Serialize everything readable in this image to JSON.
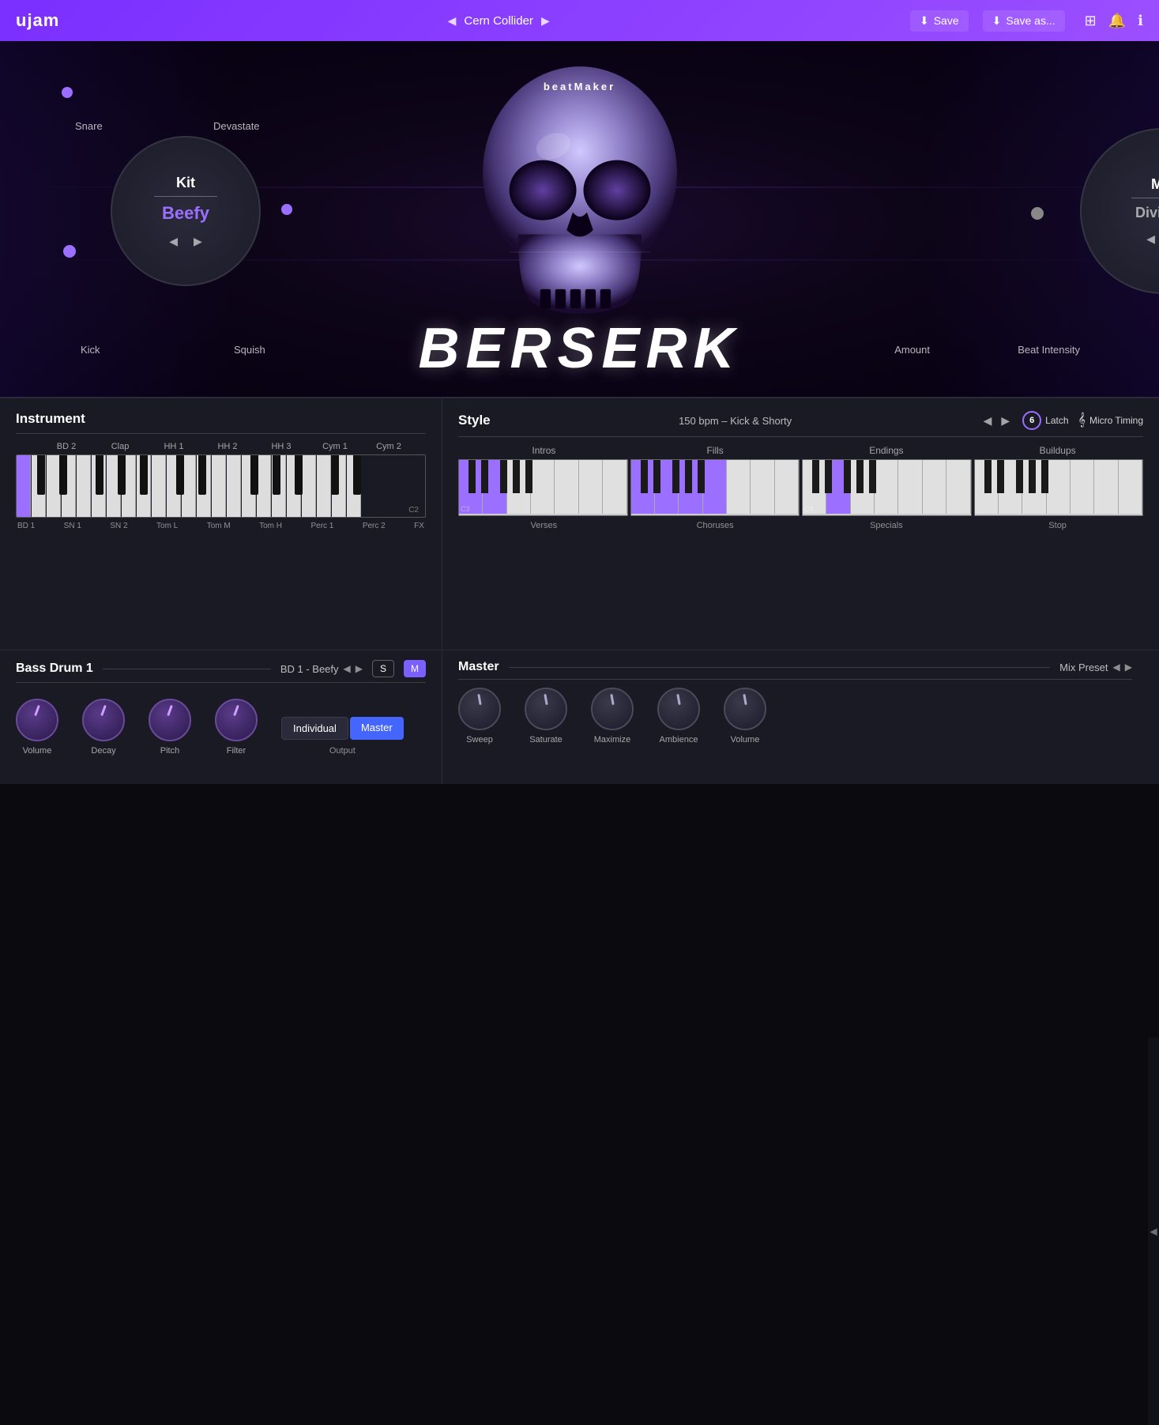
{
  "app": {
    "logo": "ujam",
    "preset_name": "Cern Collider",
    "save_label": "Save",
    "save_as_label": "Save as..."
  },
  "hero": {
    "beatmaker_label": "beatMaker",
    "product_name": "BERSERK",
    "kit_title": "Kit",
    "kit_value": "Beefy",
    "mix_title": "Mix",
    "mix_value": "Division",
    "snare_label": "Snare",
    "devastate_label": "Devastate",
    "kick_label": "Kick",
    "squish_label": "Squish",
    "amount_label": "Amount",
    "beat_intensity_label": "Beat Intensity"
  },
  "instrument": {
    "title": "Instrument",
    "keys_top": [
      "BD 2",
      "Clap",
      "HH 1",
      "HH 2",
      "HH 3",
      "Cym 1",
      "Cym 2"
    ],
    "keys_bottom": [
      "BD 1",
      "SN 1",
      "SN 2",
      "Tom L",
      "Tom M",
      "Tom H",
      "Perc 1",
      "Perc 2",
      "FX"
    ],
    "note_label": "C2"
  },
  "style": {
    "title": "Style",
    "preset": "150 bpm – Kick & Shorty",
    "latch_label": "Latch",
    "latch_number": "6",
    "micro_timing_label": "Micro Timing",
    "groups": [
      "Intros",
      "Fills",
      "Endings",
      "Buildups"
    ],
    "bottom_labels": [
      "Verses",
      "Choruses",
      "Specials",
      "Stop"
    ],
    "note_c3": "C3",
    "note_c4": "C4"
  },
  "bass_drum": {
    "title": "Bass Drum 1",
    "preset": "BD 1 - Beefy",
    "solo_label": "S",
    "mute_label": "M",
    "knobs": [
      {
        "label": "Volume",
        "value": 0
      },
      {
        "label": "Decay",
        "value": 0
      },
      {
        "label": "Pitch",
        "value": 0
      },
      {
        "label": "Filter",
        "value": 0
      }
    ],
    "output_label": "Output",
    "individual_label": "Individual",
    "master_label": "Master"
  },
  "master": {
    "title": "Master",
    "mix_preset_label": "Mix Preset",
    "knobs": [
      {
        "label": "Sweep"
      },
      {
        "label": "Saturate"
      },
      {
        "label": "Maximize"
      },
      {
        "label": "Ambience"
      },
      {
        "label": "Volume"
      }
    ]
  }
}
